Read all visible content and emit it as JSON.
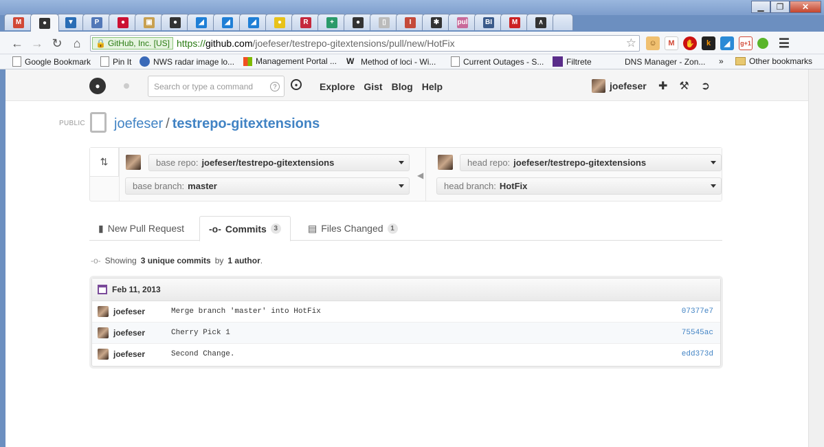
{
  "browser": {
    "window_buttons": {
      "minimize": "▁",
      "maximize": "❐",
      "close": "✕"
    },
    "tabs": [
      {
        "icon": "gmail-icon",
        "glyph": "M",
        "color": "#d14836",
        "active": false
      },
      {
        "icon": "github-icon",
        "glyph": "●",
        "color": "#333333",
        "active": true
      },
      {
        "icon": "bucket-icon",
        "glyph": "▼",
        "color": "#2a6db5",
        "active": false
      },
      {
        "icon": "pinboard-icon",
        "glyph": "P",
        "color": "#5278b8",
        "active": false
      },
      {
        "icon": "record-icon",
        "glyph": "●",
        "color": "#cc1133",
        "active": false
      },
      {
        "icon": "photo-icon",
        "glyph": "▣",
        "color": "#c8a050",
        "active": false
      },
      {
        "icon": "github-icon",
        "glyph": "●",
        "color": "#333333",
        "active": false
      },
      {
        "icon": "azure-icon",
        "glyph": "◢",
        "color": "#1f7fd6",
        "active": false
      },
      {
        "icon": "azure-icon",
        "glyph": "◢",
        "color": "#1f7fd6",
        "active": false
      },
      {
        "icon": "azure-icon",
        "glyph": "◢",
        "color": "#1f7fd6",
        "active": false
      },
      {
        "icon": "coin-icon",
        "glyph": "●",
        "color": "#e8c21a",
        "active": false
      },
      {
        "icon": "rutgers-icon",
        "glyph": "R",
        "color": "#c5283c",
        "active": false
      },
      {
        "icon": "medical-icon",
        "glyph": "+",
        "color": "#2a9a6a",
        "active": false
      },
      {
        "icon": "github-icon",
        "glyph": "●",
        "color": "#333333",
        "active": false
      },
      {
        "icon": "document-icon",
        "glyph": "▯",
        "color": "#bbbbbb",
        "active": false
      },
      {
        "icon": "i-icon",
        "glyph": "I",
        "color": "#c44a3a",
        "active": false
      },
      {
        "icon": "asterisk-icon",
        "glyph": "✱",
        "color": "#333333",
        "active": false
      },
      {
        "icon": "pul-icon",
        "glyph": "pul",
        "color": "#c86a9a",
        "active": false
      },
      {
        "icon": "bi-icon",
        "glyph": "BI",
        "color": "#3a5a8a",
        "active": false
      },
      {
        "icon": "m-icon",
        "glyph": "M",
        "color": "#cc2222",
        "active": false
      },
      {
        "icon": "caret-icon",
        "glyph": "∧",
        "color": "#333333",
        "active": false
      }
    ],
    "omnibox": {
      "ev_label": "GitHub, Inc. [US]",
      "scheme": "https://",
      "host": "github.com",
      "path": "/joefeser/testrepo-gitextensions/pull/new/HotFix"
    },
    "bookmarks": [
      {
        "label": "Google Bookmark",
        "icon": "page-icon"
      },
      {
        "label": "Pin It",
        "icon": "page-icon"
      },
      {
        "label": "NWS radar image lo...",
        "icon": "nws-icon"
      },
      {
        "label": "Management Portal ...",
        "icon": "windows-icon"
      },
      {
        "label": "Method of loci - Wi...",
        "icon": "wikipedia-icon"
      },
      {
        "label": "Current Outages - S...",
        "icon": "page-icon"
      },
      {
        "label": "Filtrete",
        "icon": "filtrete-icon"
      },
      {
        "label": "DNS Manager - Zon...",
        "icon": "blank-icon"
      }
    ],
    "bookmarks_overflow": "»",
    "other_bookmarks": "Other bookmarks"
  },
  "github": {
    "search_placeholder": "Search or type a command",
    "nav": [
      "Explore",
      "Gist",
      "Blog",
      "Help"
    ],
    "username": "joefeser",
    "repo": {
      "visibility": "PUBLIC",
      "owner": "joefeser",
      "separator": "/",
      "name": "testrepo-gitextensions"
    },
    "compare": {
      "base_repo_label": "base repo:",
      "base_repo": "joefeser/testrepo-gitextensions",
      "base_branch_label": "base branch:",
      "base_branch": "master",
      "head_repo_label": "head repo:",
      "head_repo": "joefeser/testrepo-gitextensions",
      "head_branch_label": "head branch:",
      "head_branch": "HotFix"
    },
    "tabs": [
      {
        "label": "New Pull Request",
        "count": null
      },
      {
        "label": "Commits",
        "count": "3"
      },
      {
        "label": "Files Changed",
        "count": "1"
      }
    ],
    "summary": {
      "prefix": "Showing",
      "count_text": "3 unique commits",
      "mid": "by",
      "authors_text": "1 author",
      "suffix": "."
    },
    "commit_date": "Feb 11, 2013",
    "commits": [
      {
        "author": "joefeser",
        "message": "Merge branch 'master' into HotFix",
        "sha": "07377e7"
      },
      {
        "author": "joefeser",
        "message": "Cherry Pick 1",
        "sha": "75545ac"
      },
      {
        "author": "joefeser",
        "message": "Second Change.",
        "sha": "edd373d"
      }
    ]
  }
}
